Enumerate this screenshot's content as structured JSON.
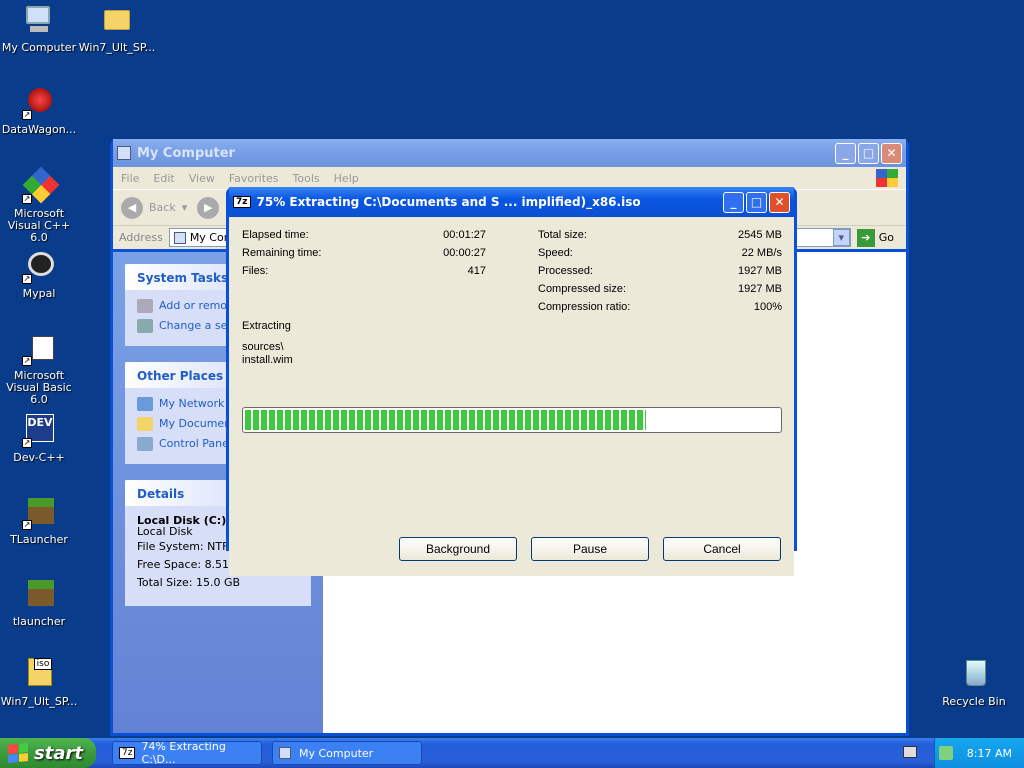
{
  "desktop": {
    "icons": [
      {
        "label": "My Computer",
        "icon": "my-computer-icon"
      },
      {
        "label": "Win7_Ult_SP...",
        "icon": "folder-icon"
      },
      {
        "label": "DataWagon...",
        "icon": "datawagon-icon"
      },
      {
        "label": "Microsoft Visual C++ 6.0",
        "icon": "visual-cpp-icon"
      },
      {
        "label": "Mypal",
        "icon": "mypal-icon"
      },
      {
        "label": "Microsoft Visual Basic 6.0",
        "icon": "visual-basic-icon"
      },
      {
        "label": "Dev-C++",
        "icon": "devcpp-icon"
      },
      {
        "label": "TLauncher",
        "icon": "tlauncher-icon"
      },
      {
        "label": "tlauncher",
        "icon": "tlauncher-icon"
      },
      {
        "label": "Win7_Ult_SP...",
        "icon": "iso-file-icon"
      },
      {
        "label": "Recycle Bin",
        "icon": "recycle-bin-icon"
      }
    ],
    "dev_badge": "DEV",
    "iso_badge": "iso"
  },
  "explorer": {
    "title": "My Computer",
    "menu": [
      "File",
      "Edit",
      "View",
      "Favorites",
      "Tools",
      "Help"
    ],
    "back_label": "Back",
    "address_label": "Address",
    "address_value": "My Comp",
    "go_label": "Go",
    "system_tasks": {
      "title": "System Tasks",
      "items": [
        "Add or remov",
        "Change a set"
      ]
    },
    "other_places": {
      "title": "Other Places",
      "items": [
        "My Network P",
        "My Document",
        "Control Panel"
      ]
    },
    "details": {
      "title": "Details",
      "name": "Local Disk (C:)",
      "type": "Local Disk",
      "file_system": "File System: NTFS",
      "free_space": "Free Space: 8.51 GB",
      "total_size": "Total Size: 15.0 GB"
    }
  },
  "progress": {
    "title": "75% Extracting C:\\Documents and S ... implified)_x86.iso",
    "app_badge": "7z",
    "elapsed_label": "Elapsed time:",
    "elapsed_value": "00:01:27",
    "remaining_label": "Remaining time:",
    "remaining_value": "00:00:27",
    "files_label": "Files:",
    "files_value": "417",
    "total_size_label": "Total size:",
    "total_size_value": "2545 MB",
    "speed_label": "Speed:",
    "speed_value": "22 MB/s",
    "processed_label": "Processed:",
    "processed_value": "1927 MB",
    "compressed_size_label": "Compressed size:",
    "compressed_size_value": "1927 MB",
    "ratio_label": "Compression ratio:",
    "ratio_value": "100%",
    "status_label": "Extracting",
    "path_line1": "sources\\",
    "path_line2": "install.wim",
    "percent": 75,
    "buttons": {
      "background": "Background",
      "pause": "Pause",
      "cancel": "Cancel"
    }
  },
  "taskbar": {
    "start_label": "start",
    "items": [
      {
        "label": "74% Extracting C:\\D...",
        "badge": "7z"
      },
      {
        "label": "My Computer"
      }
    ],
    "clock": "8:17 AM"
  },
  "colors": {
    "desktop": "#0a3c8c",
    "accent": "#0a4fd8",
    "progress": "#3dc93d"
  }
}
